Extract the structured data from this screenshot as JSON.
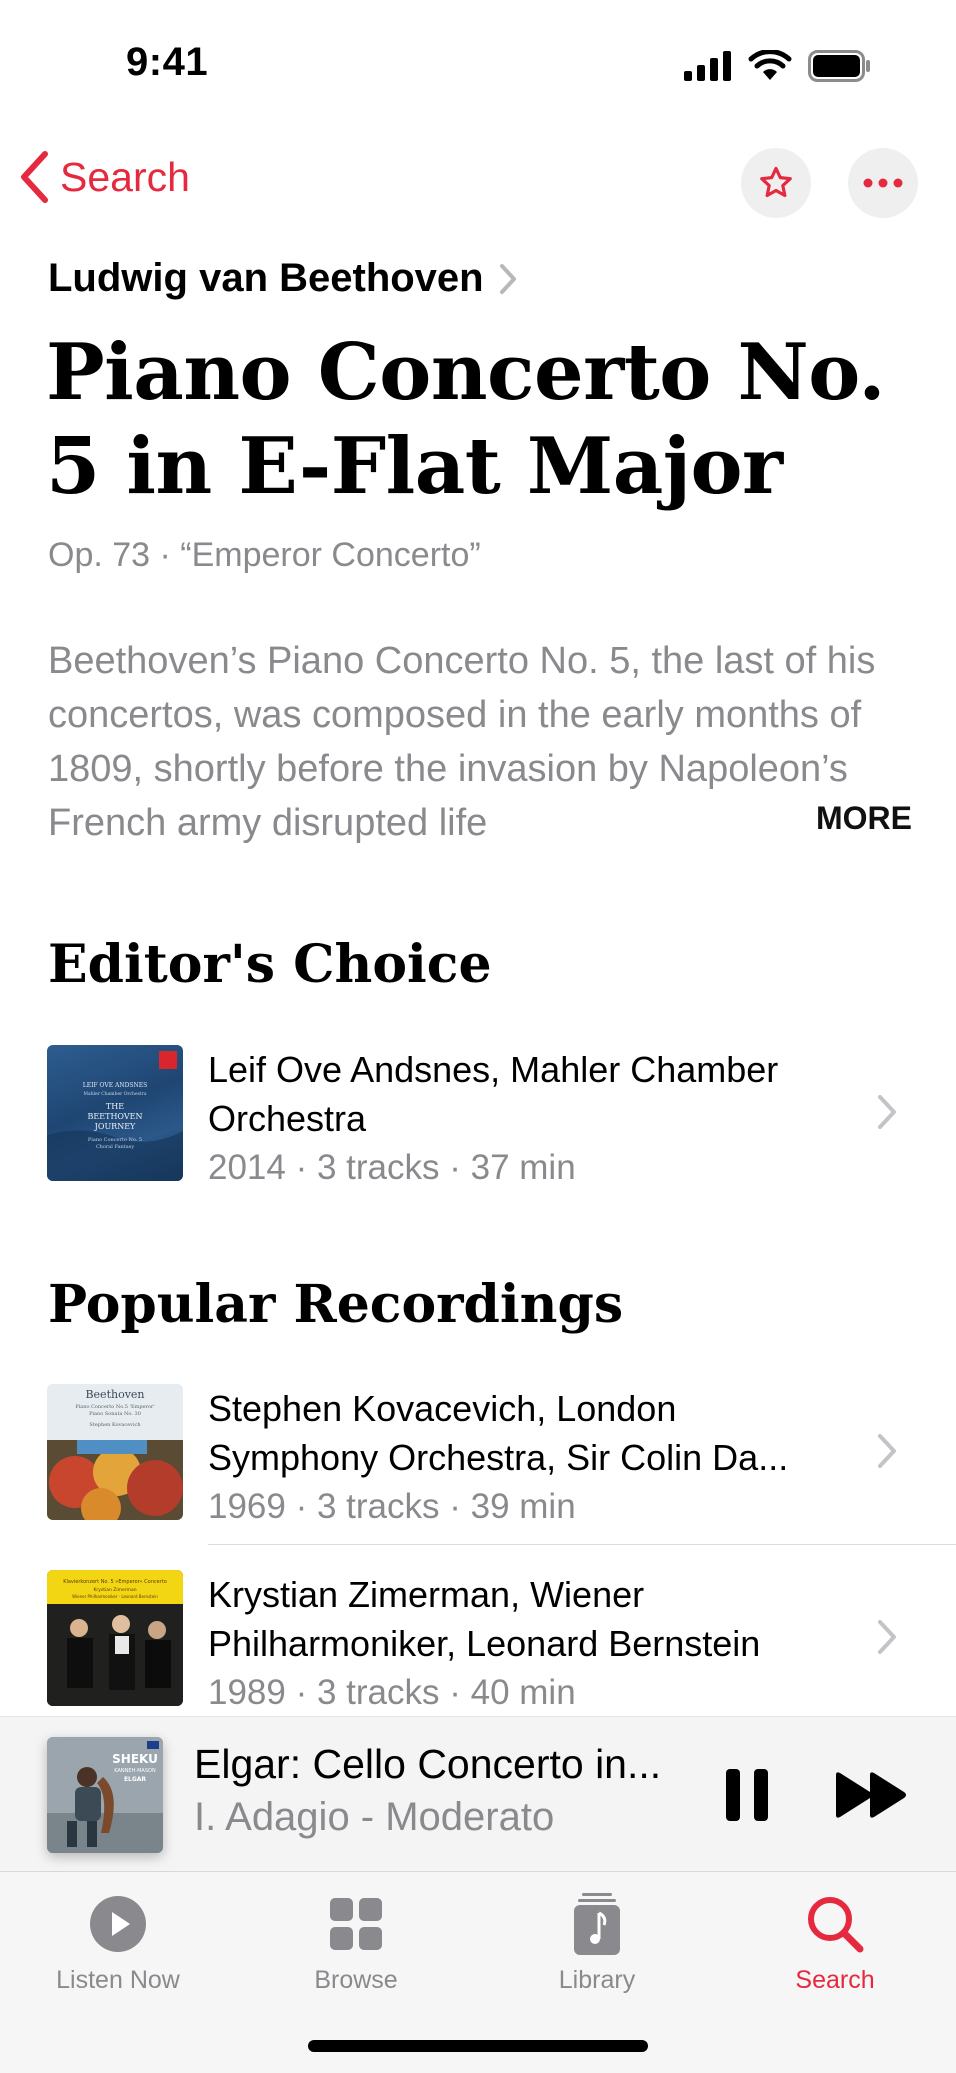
{
  "status_bar": {
    "time": "9:41"
  },
  "nav": {
    "back_label": "Search"
  },
  "work": {
    "composer": "Ludwig van Beethoven",
    "title": "Piano Concerto No. 5 in E-Flat Major",
    "subtitle": "Op. 73 · “Emperor Concerto”",
    "description": "Beethoven’s Piano Concerto No. 5, the last of his concertos, was composed in the early months of 1809, shortly before the invasion by Napoleon’s French army disrupted life",
    "more_label": "MORE"
  },
  "editors_choice": {
    "title": "Editor's Choice",
    "items": [
      {
        "artists": "Leif Ove Andsnes, Mahler Chamber Orchestra",
        "meta": "2014 · 3 tracks · 37 min",
        "cover_lines": [
          "LEIF OVE ANDSNES",
          "Mahler Chamber Orchestra",
          "THE",
          "BEETHOVEN",
          "JOURNEY",
          "Piano Concerto No. 5",
          "Choral Fantasy"
        ]
      }
    ]
  },
  "popular": {
    "title": "Popular Recordings",
    "items": [
      {
        "artists": "Stephen Kovacevich, London Symphony Orchestra, Sir Colin Da...",
        "meta": "1969 · 3 tracks · 39 min",
        "cover_lines": [
          "Beethoven",
          "Piano Concerto No.5 'Emperor'",
          "Piano Sonata No. 30",
          "Stephen Kovacevich"
        ]
      },
      {
        "artists": "Krystian Zimerman, Wiener Philharmoniker, Leonard Bernstein",
        "meta": "1989 · 3 tracks · 40 min",
        "cover_lines": [
          "Klavierkonzert No. 5 »Emperor« Concerto",
          "Krystian Zimerman",
          "Wiener Philharmoniker · Leonard Bernstein"
        ]
      }
    ]
  },
  "now_playing": {
    "title": "Elgar: Cello Concerto in...",
    "subtitle": "I. Adagio - Moderato",
    "cover_lines": [
      "SHEKU",
      "KANNEH-MASON",
      "ELGAR"
    ]
  },
  "tabs": [
    {
      "label": "Listen Now",
      "icon": "play-circle-icon",
      "active": false
    },
    {
      "label": "Browse",
      "icon": "grid-icon",
      "active": false
    },
    {
      "label": "Library",
      "icon": "music-note-icon",
      "active": false
    },
    {
      "label": "Search",
      "icon": "search-icon",
      "active": true
    }
  ],
  "colors": {
    "accent": "#e5293f",
    "secondary_text": "#8a8a8e"
  }
}
